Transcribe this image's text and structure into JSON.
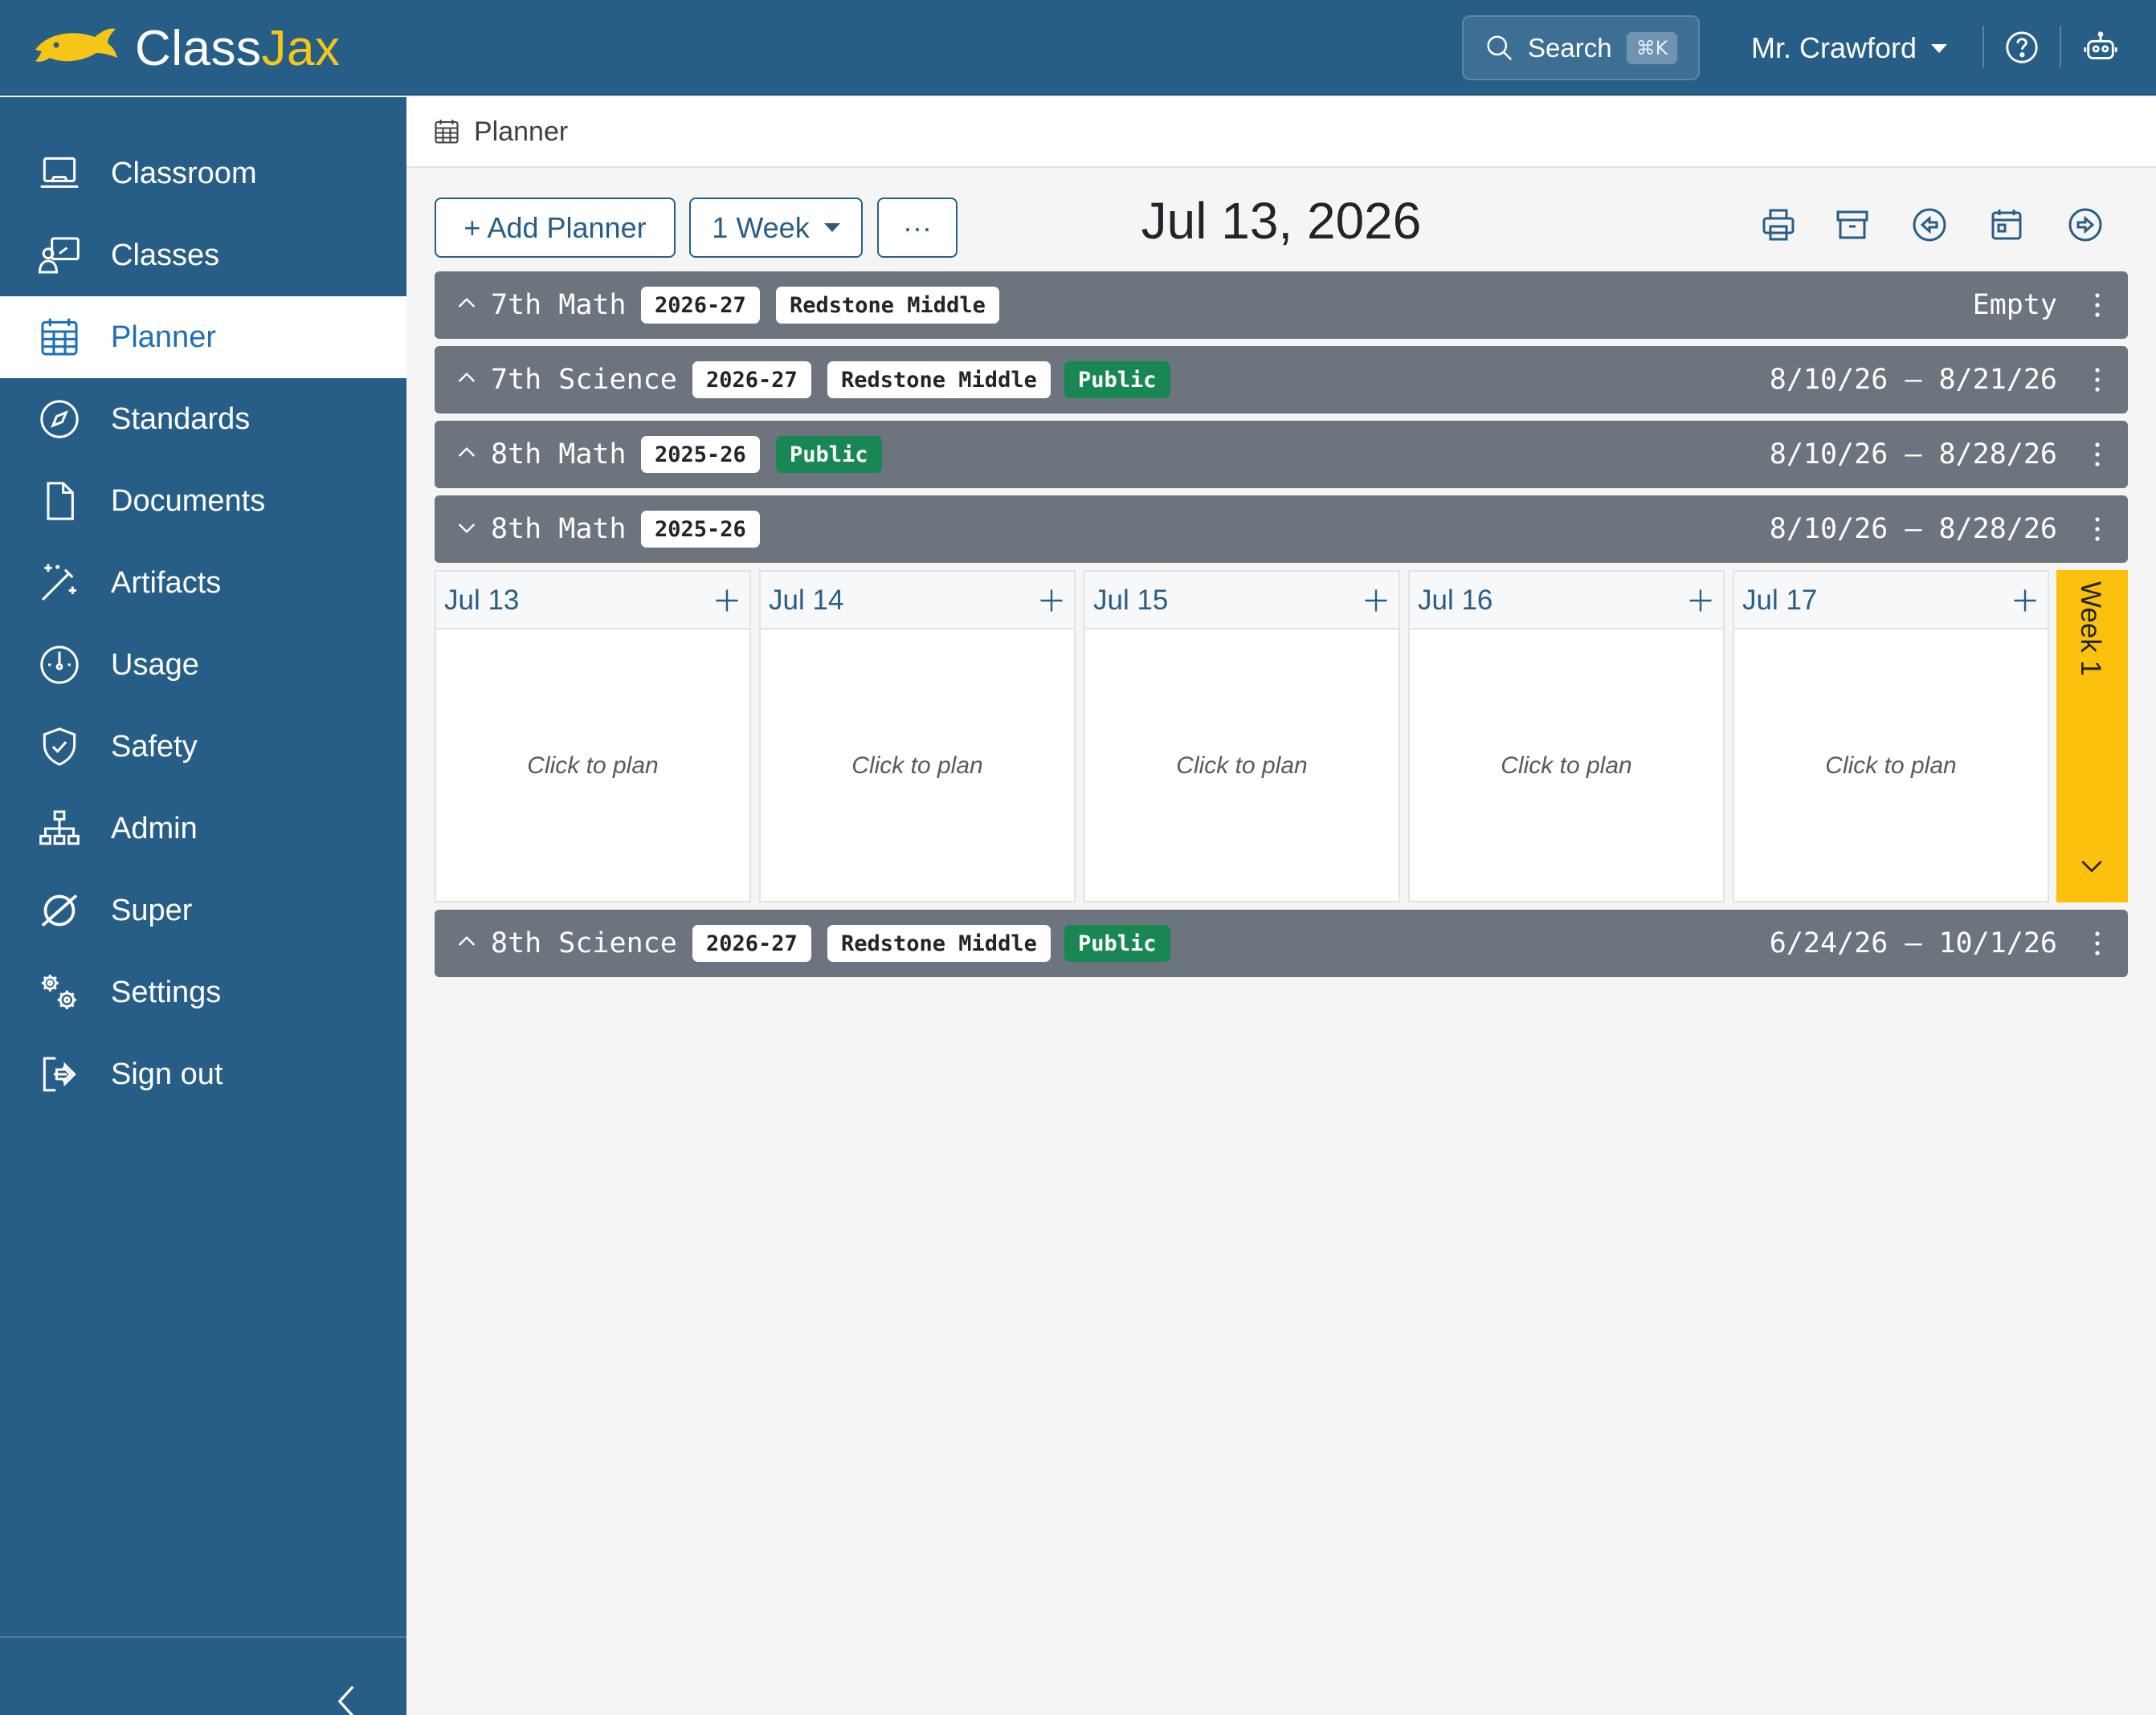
{
  "app": {
    "logo_part1": "Class",
    "logo_part2": "Jax"
  },
  "header": {
    "search_label": "Search",
    "search_shortcut": "⌘K",
    "user_name": "Mr. Crawford"
  },
  "sidebar": {
    "items": [
      {
        "label": "Classroom",
        "icon": "laptop-icon"
      },
      {
        "label": "Classes",
        "icon": "classes-icon"
      },
      {
        "label": "Planner",
        "icon": "calendar-grid-icon",
        "active": true
      },
      {
        "label": "Standards",
        "icon": "compass-icon"
      },
      {
        "label": "Documents",
        "icon": "document-icon"
      },
      {
        "label": "Artifacts",
        "icon": "magic-wand-icon"
      },
      {
        "label": "Usage",
        "icon": "speedometer-icon"
      },
      {
        "label": "Safety",
        "icon": "shield-check-icon"
      },
      {
        "label": "Admin",
        "icon": "org-chart-icon"
      },
      {
        "label": "Super",
        "icon": "super-icon"
      },
      {
        "label": "Settings",
        "icon": "gears-icon"
      },
      {
        "label": "Sign out",
        "icon": "sign-out-icon"
      }
    ]
  },
  "breadcrumb": {
    "label": "Planner"
  },
  "toolbar": {
    "add_label": "+ Add Planner",
    "range_label": "1 Week",
    "more_label": "···",
    "current_date": "Jul 13, 2026"
  },
  "planners": [
    {
      "name": "7th Math",
      "year": "2026-27",
      "school": "Redstone Middle",
      "public": "",
      "range": "Empty",
      "expanded": false
    },
    {
      "name": "7th Science",
      "year": "2026-27",
      "school": "Redstone Middle",
      "public": "Public",
      "range": "8/10/26 – 8/21/26",
      "expanded": false
    },
    {
      "name": "8th Math",
      "year": "2025-26",
      "school": "",
      "public": "Public",
      "range": "8/10/26 – 8/28/26",
      "expanded": false
    },
    {
      "name": "8th Math",
      "year": "2025-26",
      "school": "",
      "public": "",
      "range": "8/10/26 – 8/28/26",
      "expanded": true
    },
    {
      "name": "8th Science",
      "year": "2026-27",
      "school": "Redstone Middle",
      "public": "Public",
      "range": "6/24/26 – 10/1/26",
      "expanded": false
    }
  ],
  "week": {
    "label": "Week 1",
    "days": [
      {
        "label": "Jul 13",
        "hint": "Click to plan"
      },
      {
        "label": "Jul 14",
        "hint": "Click to plan"
      },
      {
        "label": "Jul 15",
        "hint": "Click to plan"
      },
      {
        "label": "Jul 16",
        "hint": "Click to plan"
      },
      {
        "label": "Jul 17",
        "hint": "Click to plan"
      }
    ]
  },
  "colors": {
    "brand": "#275e87",
    "accent": "#f5c518",
    "row": "#6c757d",
    "public": "#198754",
    "week_tab": "#fcc10d"
  }
}
